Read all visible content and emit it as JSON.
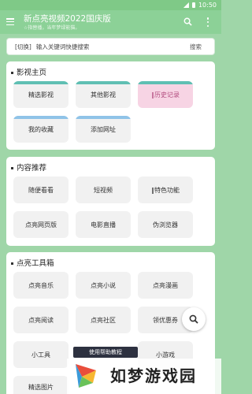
{
  "status": {
    "time": "10:50"
  },
  "appbar": {
    "title": "新点亮视频2022国庆版",
    "subtitle": "☆指替播，当年梦绿能猫。"
  },
  "search": {
    "switch_label": "[切换]",
    "placeholder": "输入关键词快捷搜索",
    "button_label": "搜索"
  },
  "sections": {
    "home": {
      "title": "影视主页",
      "items": [
        "精选影视",
        "其他影视",
        "‖历史记录",
        "我的收藏",
        "添加网址"
      ]
    },
    "recommend": {
      "title": "内容推荐",
      "items": [
        "随便看看",
        "短视频",
        "‖特色功能",
        "点亮网页版",
        "电影直播",
        "伪浏览器"
      ]
    },
    "tools": {
      "title": "点亮工具箱",
      "items": [
        "点亮音乐",
        "点亮小说",
        "点亮漫画",
        "点亮阅读",
        "点亮社区",
        "领优惠券",
        "小工具",
        "小游戏",
        "精选图片"
      ]
    }
  },
  "toast": {
    "text": "使用帮助教程"
  },
  "watermark": {
    "text": "如梦游戏园"
  },
  "colors": {
    "accent": "#8cd197",
    "background": "#9fd6a8",
    "teal_strip": "#5fbfb3",
    "blue_strip": "#8fc3e8",
    "pink": "#f7d4e4"
  }
}
